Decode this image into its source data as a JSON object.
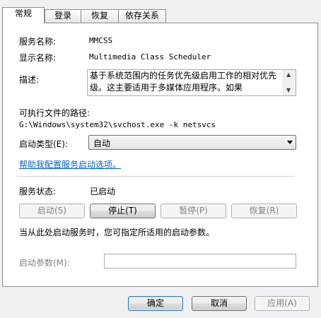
{
  "tabs": [
    {
      "label": "常规",
      "active": true
    },
    {
      "label": "登录",
      "active": false
    },
    {
      "label": "恢复",
      "active": false
    },
    {
      "label": "依存关系",
      "active": false
    }
  ],
  "general": {
    "service_name_label": "服务名称:",
    "service_name_value": "MMCSS",
    "display_name_label": "显示名称:",
    "display_name_value": "Multimedia Class Scheduler",
    "description_label": "描述:",
    "description_value": "基于系统范围内的任务优先级启用工作的相对优先级。这主要适用于多媒体应用程序。如果",
    "path_label": "可执行文件的路径:",
    "path_value": "G:\\Windows\\system32\\svchost.exe -k netsvcs",
    "startup_type_label": "启动类型(E):",
    "startup_type_value": "自动",
    "help_link": "帮助我配置服务启动选项。",
    "status_label": "服务状态:",
    "status_value": "已启动",
    "start_button": "启动(S)",
    "stop_button": "停止(T)",
    "pause_button": "暂停(P)",
    "resume_button": "恢复(R)",
    "hint_text": "当从此处启动服务时，您可指定所适用的启动参数。",
    "start_params_label": "启动参数(M):",
    "start_params_value": ""
  },
  "footer": {
    "ok_button": "确定",
    "cancel_button": "取消",
    "apply_button": "应用(A)"
  }
}
